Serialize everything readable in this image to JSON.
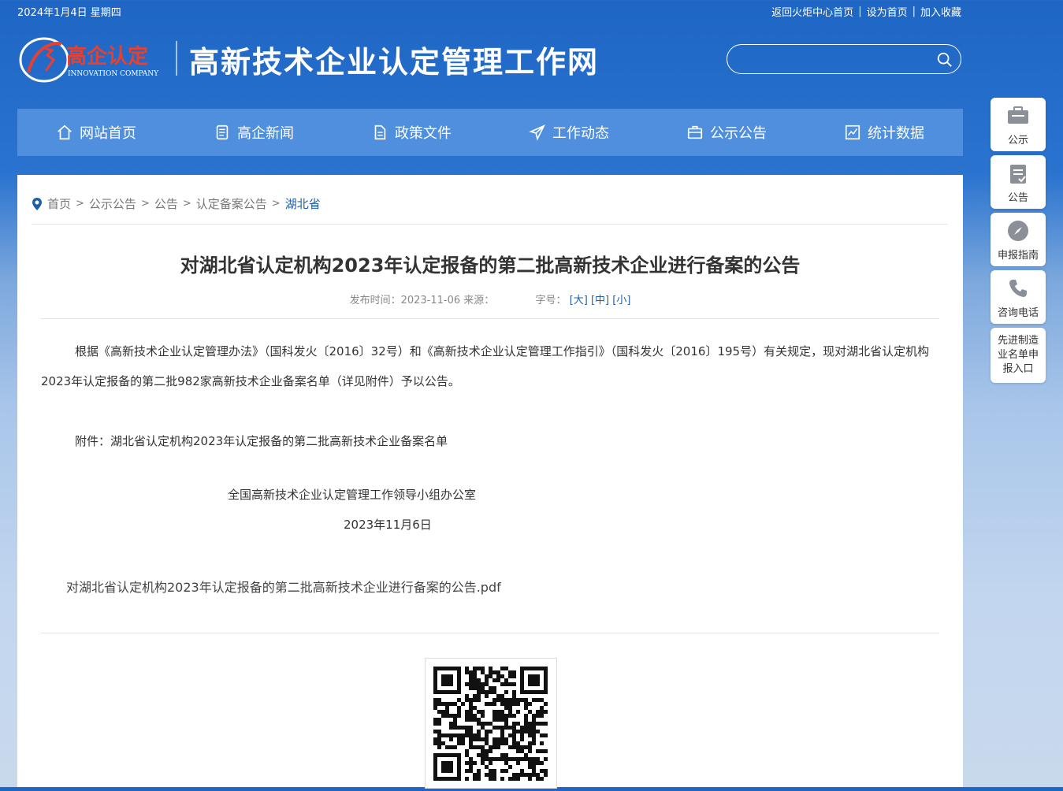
{
  "topbar": {
    "date": "2024年1月4日 星期四",
    "links": [
      "返回火炬中心首页",
      "设为首页",
      "加入收藏"
    ]
  },
  "header": {
    "logo_text": "高企认定",
    "logo_sub": "INNOVATION COMPANY",
    "site_title": "高新技术企业认定管理工作网",
    "search_placeholder": ""
  },
  "nav": [
    {
      "label": "网站首页",
      "icon": "home-icon"
    },
    {
      "label": "高企新闻",
      "icon": "news-icon"
    },
    {
      "label": "政策文件",
      "icon": "document-icon"
    },
    {
      "label": "工作动态",
      "icon": "paper-plane-icon"
    },
    {
      "label": "公示公告",
      "icon": "briefcase-icon"
    },
    {
      "label": "统计数据",
      "icon": "chart-icon"
    }
  ],
  "breadcrumb": {
    "items": [
      "首页",
      "公示公告",
      "公告",
      "认定备案公告"
    ],
    "current": "湖北省"
  },
  "article": {
    "title": "对湖北省认定机构2023年认定报备的第二批高新技术企业进行备案的公告",
    "meta_prefix": "发布时间：2023-11-06 来源：",
    "meta_size_label": "字号：",
    "size_large": "[大]",
    "size_medium": "[中]",
    "size_small": "[小]",
    "paragraph1": "根据《高新技术企业认定管理办法》（国科发火〔2016〕32号）和《高新技术企业认定管理工作指引》（国科发火〔2016〕195号）有关规定，现对湖北省认定机构2023年认定报备的第二批982家高新技术企业备案名单（详见附件）予以公告。",
    "attachment_note": "附件：湖北省认定机构2023年认定报备的第二批高新技术企业备案名单",
    "signature": "全国高新技术企业认定管理工作领导小组办公室",
    "sign_date": "2023年11月6日",
    "attachment_link": "对湖北省认定机构2023年认定报备的第二批高新技术企业进行备案的公告.pdf"
  },
  "side": [
    {
      "label": "公示",
      "icon": "notice-board-icon"
    },
    {
      "label": "公告",
      "icon": "clipboard-icon"
    },
    {
      "label": "申报指南",
      "icon": "compass-icon"
    },
    {
      "label": "咨询电话",
      "icon": "phone-icon"
    },
    {
      "label": "先进制造业名单申报入口"
    }
  ]
}
